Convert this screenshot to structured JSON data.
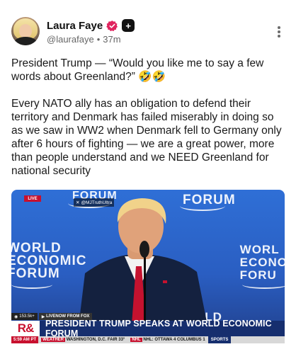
{
  "author": {
    "display_name": "Laura Faye",
    "handle": "@laurafaye",
    "separator": "•",
    "time": "37m",
    "app_badge": "+"
  },
  "icons": {
    "verified": "verified-badge-icon",
    "app_badge": "app-badge-icon",
    "more": "more-vertical-icon"
  },
  "post": {
    "paragraph_1": "President Trump — “Would you like me to say a few words about Greenland?” 🤣🤣",
    "paragraph_2": "Every NATO ally has an obligation to defend their territory and Denmark has failed miserably in doing so as we saw in WW2 when Denmark fell to Germany only after 6 hours of fighting — we are a great power, more than people understand and we NEED Greenland for national security"
  },
  "media": {
    "live_label": "LIVE",
    "overlay_handle": "@MJTruthUltra",
    "backdrop_left": [
      "WORLD",
      "ECONOMIC",
      "FORUM"
    ],
    "backdrop_right": [
      "WORL",
      "ECONO",
      "FORU"
    ],
    "backdrop_top_left": "FORUM",
    "backdrop_top_right": "FORUM",
    "backdrop_bottom_right": "RLD",
    "lower_third": {
      "views": "153.5k+",
      "source": "LIVENOW FROM FOX",
      "logo": "R&",
      "headline": "PRESIDENT TRUMP SPEAKS AT WORLD ECONOMIC FORUM",
      "ticker_time": "5:59 AM PT",
      "ticker_tag": "WEATHER",
      "ticker_weather": "WASHINGTON, D.C.  FAIR 33°",
      "ticker_tag_2": "NHL",
      "ticker_score": "NHL:  OTTAWA  4  COLUMBUS  1",
      "ticker_sports": "SPORTS"
    }
  },
  "colors": {
    "verified": "#e0245e",
    "stage_blue": "#2f6fd6",
    "headline_bar": "#162e6e",
    "accent_red": "#c8102e"
  }
}
